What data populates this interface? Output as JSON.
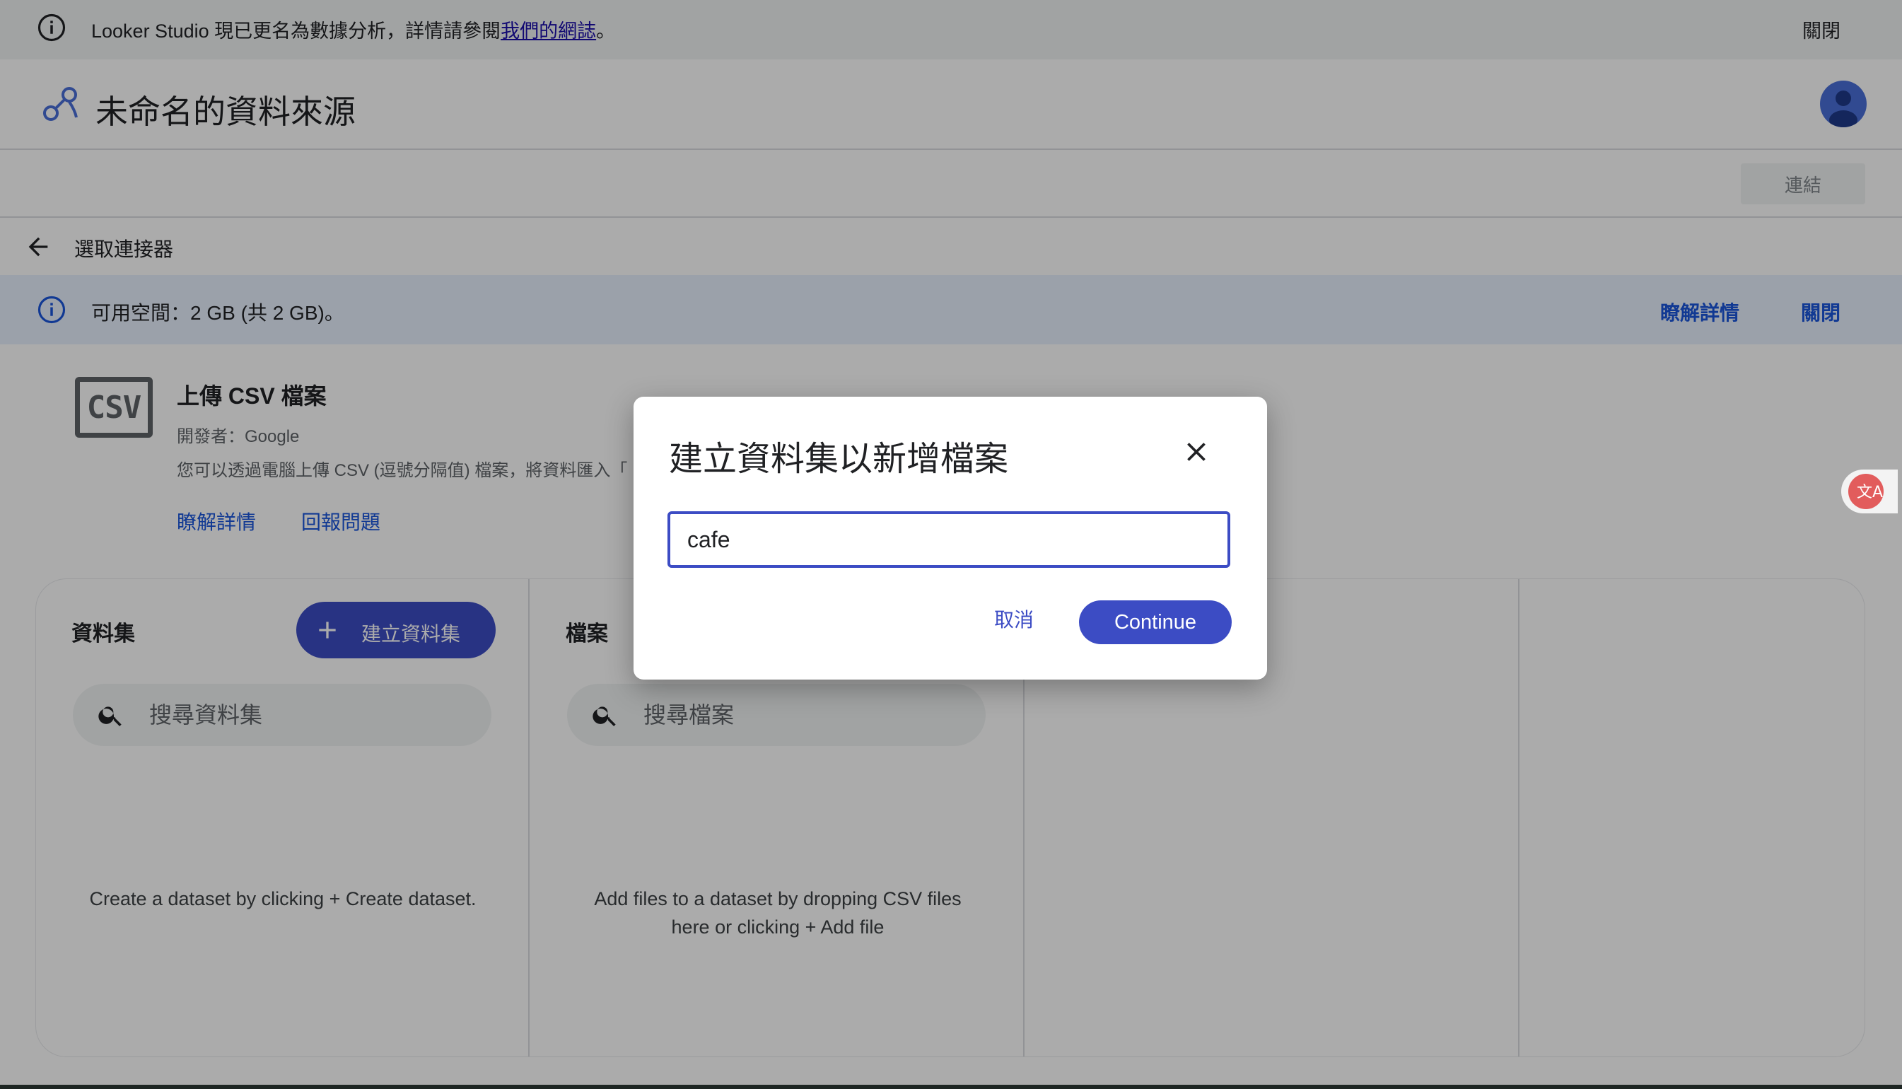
{
  "notice": {
    "text_before_link": "Looker Studio 現已更名為數據分析，詳情請參閱",
    "link": "我們的網誌",
    "text_after_link": "。",
    "close": "關閉"
  },
  "header": {
    "title": "未命名的資料來源"
  },
  "toolbar": {
    "connect": "連結"
  },
  "nav": {
    "label": "選取連接器"
  },
  "quota": {
    "text": "可用空間：2 GB (共 2 GB)。",
    "learn_more": "瞭解詳情",
    "close": "關閉"
  },
  "connector": {
    "icon_text": "CSV",
    "name": "上傳 CSV 檔案",
    "developer": "開發者：Google",
    "description": "您可以透過電腦上傳 CSV (逗號分隔值) 檔案，將資料匯入「",
    "learn_more": "瞭解詳情",
    "report_issue": "回報問題"
  },
  "datasets": {
    "heading": "資料集",
    "create_button": "建立資料集",
    "search_placeholder": "搜尋資料集",
    "empty_text": "Create a dataset by clicking + Create dataset."
  },
  "files": {
    "heading": "檔案",
    "search_placeholder": "搜尋檔案",
    "empty_text": "Add files to a dataset by dropping CSV files here or clicking + Add file"
  },
  "dialog": {
    "title": "建立資料集以新增檔案",
    "input_value": "cafe",
    "cancel": "取消",
    "continue": "Continue"
  },
  "colors": {
    "accent": "#3c4cc4",
    "link": "#1a56db",
    "quota_banner": "#e8f0fe"
  }
}
